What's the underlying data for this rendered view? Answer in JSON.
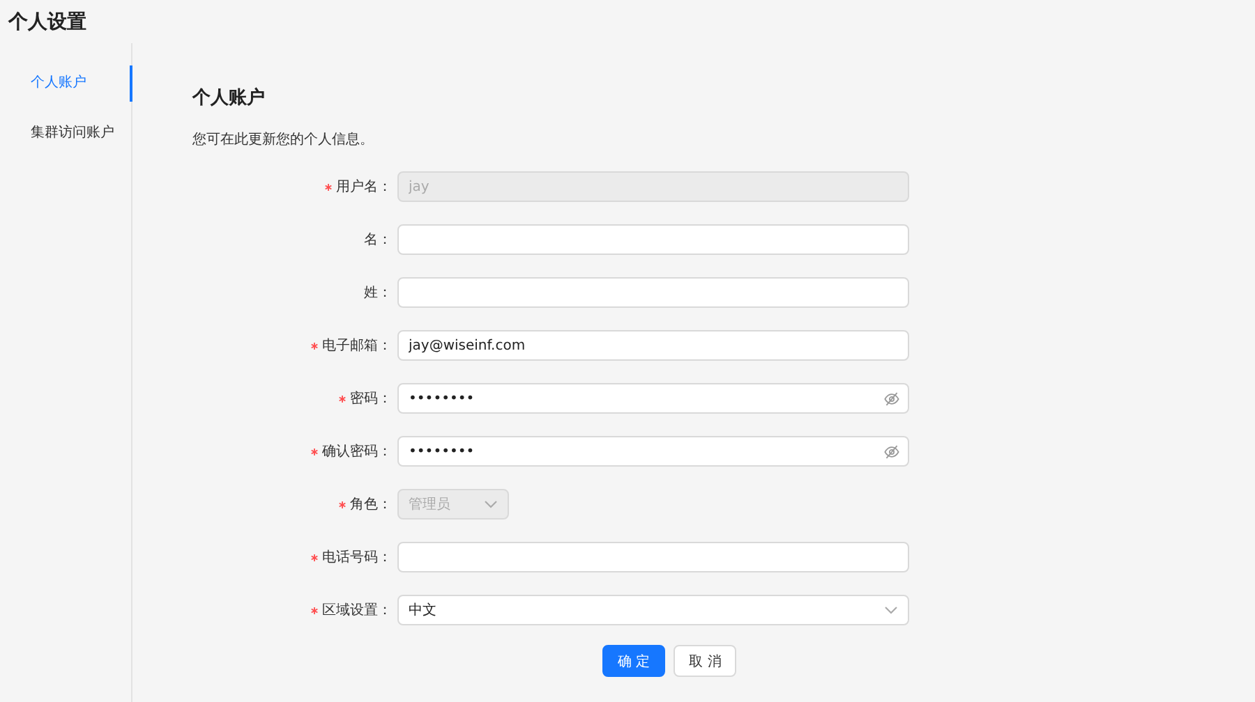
{
  "page_title": "个人设置",
  "sidebar": {
    "items": [
      {
        "label": "个人账户",
        "selected": true
      },
      {
        "label": "集群访问账户",
        "selected": false
      }
    ]
  },
  "heading": "个人账户",
  "description": "您可在此更新您的个人信息。",
  "fields": [
    {
      "label": "用户名：",
      "required": true,
      "kind": "text",
      "value": "jay",
      "disabled": true
    },
    {
      "label": "名：",
      "required": false,
      "kind": "text",
      "disabled": false
    },
    {
      "label": "姓：",
      "required": false,
      "kind": "text",
      "disabled": false
    },
    {
      "label": "电子邮箱：",
      "required": true,
      "kind": "text",
      "value": "jay@wiseinf.com",
      "disabled": false
    },
    {
      "label": "密码：",
      "required": true,
      "kind": "password",
      "value": "••••••••",
      "disabled": false
    },
    {
      "label": "确认密码：",
      "required": true,
      "kind": "password",
      "value": "••••••••",
      "disabled": false
    },
    {
      "label": "角色：",
      "required": true,
      "kind": "select-small",
      "value": "管理员",
      "disabled": true
    },
    {
      "label": "电话号码：",
      "required": true,
      "kind": "text",
      "disabled": false
    },
    {
      "label": "区域设置：",
      "required": true,
      "kind": "select",
      "value": "中文",
      "disabled": false
    }
  ],
  "buttons": [
    {
      "label": "确 定",
      "kind": "primary"
    },
    {
      "label": "取 消",
      "kind": "default"
    }
  ]
}
